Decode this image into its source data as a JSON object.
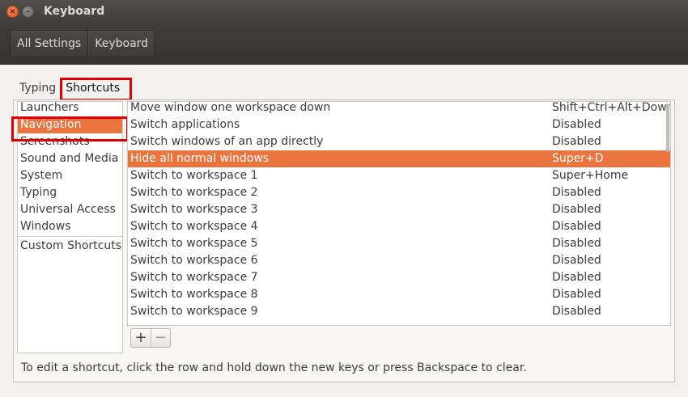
{
  "window": {
    "title": "Keyboard",
    "close_glyph": "×",
    "minimize_glyph": "–"
  },
  "toolbar": {
    "crumbs": [
      "All Settings",
      "Keyboard"
    ]
  },
  "tabs": [
    {
      "label": "Typing",
      "active": false
    },
    {
      "label": "Shortcuts",
      "active": true
    }
  ],
  "sidebar": {
    "items": [
      "Launchers",
      "Navigation",
      "Screenshots",
      "Sound and Media",
      "System",
      "Typing",
      "Universal Access",
      "Windows"
    ],
    "selected": "Navigation",
    "custom": "Custom Shortcuts"
  },
  "shortcuts": {
    "rows": [
      {
        "action": "Move window one workspace down",
        "accel": "Shift+Ctrl+Alt+Down"
      },
      {
        "action": "Switch applications",
        "accel": "Disabled"
      },
      {
        "action": "Switch windows of an app directly",
        "accel": "Disabled"
      },
      {
        "action": "Hide all normal windows",
        "accel": "Super+D"
      },
      {
        "action": "Switch to workspace 1",
        "accel": "Super+Home"
      },
      {
        "action": "Switch to workspace 2",
        "accel": "Disabled"
      },
      {
        "action": "Switch to workspace 3",
        "accel": "Disabled"
      },
      {
        "action": "Switch to workspace 4",
        "accel": "Disabled"
      },
      {
        "action": "Switch to workspace 5",
        "accel": "Disabled"
      },
      {
        "action": "Switch to workspace 6",
        "accel": "Disabled"
      },
      {
        "action": "Switch to workspace 7",
        "accel": "Disabled"
      },
      {
        "action": "Switch to workspace 8",
        "accel": "Disabled"
      },
      {
        "action": "Switch to workspace 9",
        "accel": "Disabled"
      }
    ],
    "selected_index": 3
  },
  "buttons": {
    "add": "+",
    "remove": "−"
  },
  "hint": "To edit a shortcut, click the row and hold down the new keys or press Backspace to clear.",
  "colors": {
    "accent": "#e9743d",
    "highlight_box": "#e00000"
  }
}
